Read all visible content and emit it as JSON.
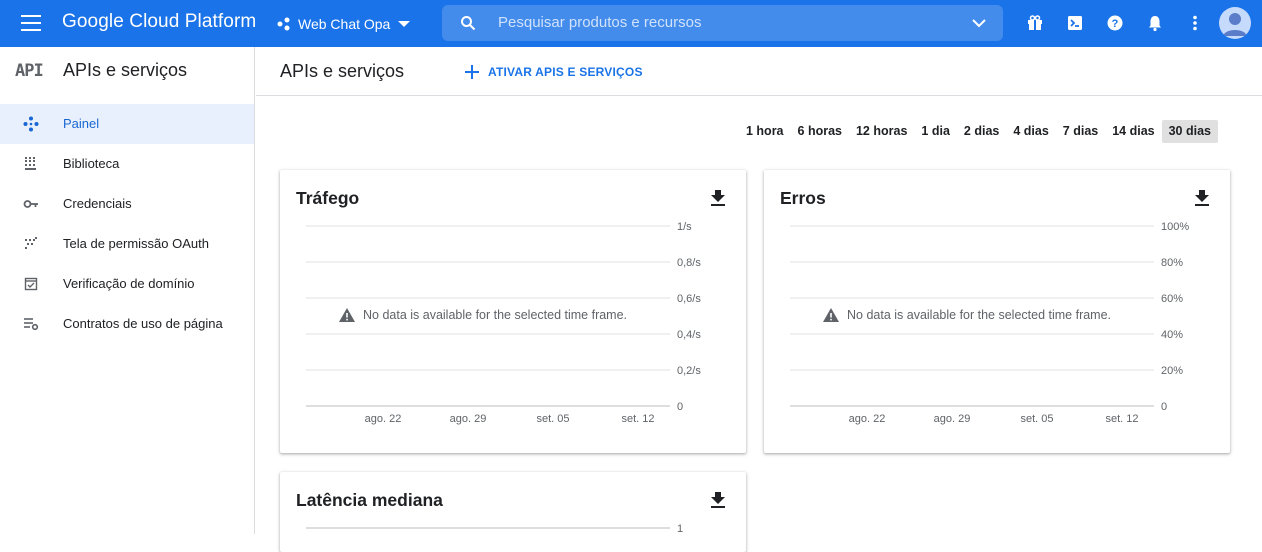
{
  "topbar": {
    "app_title": "Google Cloud Platform",
    "project_name": "Web Chat Opa",
    "search_placeholder": "Pesquisar produtos e recursos",
    "brand_color": "#1a73e8"
  },
  "sidebar": {
    "logo_text": "API",
    "title": "APIs e serviços",
    "items": [
      {
        "label": "Painel",
        "icon": "dashboard-icon",
        "active": true
      },
      {
        "label": "Biblioteca",
        "icon": "library-icon",
        "active": false
      },
      {
        "label": "Credenciais",
        "icon": "key-icon",
        "active": false
      },
      {
        "label": "Tela de permissão OAuth",
        "icon": "oauth-consent-icon",
        "active": false
      },
      {
        "label": "Verificação de domínio",
        "icon": "domain-verification-icon",
        "active": false
      },
      {
        "label": "Contratos de uso de página",
        "icon": "page-usage-agreements-icon",
        "active": false
      }
    ]
  },
  "main": {
    "title": "APIs e serviços",
    "enable_button": "ATIVAR APIS E SERVIÇOS",
    "time_ranges": [
      "1 hora",
      "6 horas",
      "12 horas",
      "1 dia",
      "2 dias",
      "4 dias",
      "7 dias",
      "14 dias",
      "30 dias"
    ],
    "selected_time_range": "30 dias",
    "no_data_message": "No data is available for the selected time frame."
  },
  "chart_data": [
    {
      "type": "line",
      "title": "Tráfego",
      "x_ticks": [
        "ago. 22",
        "ago. 29",
        "set. 05",
        "set. 12"
      ],
      "y_ticks": [
        "1/s",
        "0,8/s",
        "0,6/s",
        "0,4/s",
        "0,2/s",
        "0"
      ],
      "ylim": [
        0,
        1
      ],
      "series": [],
      "grid": true
    },
    {
      "type": "line",
      "title": "Erros",
      "x_ticks": [
        "ago. 22",
        "ago. 29",
        "set. 05",
        "set. 12"
      ],
      "y_ticks": [
        "100%",
        "80%",
        "60%",
        "40%",
        "20%",
        "0"
      ],
      "ylim": [
        0,
        100
      ],
      "series": [],
      "grid": true
    },
    {
      "type": "line",
      "title": "Latência mediana",
      "x_ticks": [],
      "y_ticks": [
        "1"
      ],
      "series": [],
      "grid": true
    }
  ]
}
